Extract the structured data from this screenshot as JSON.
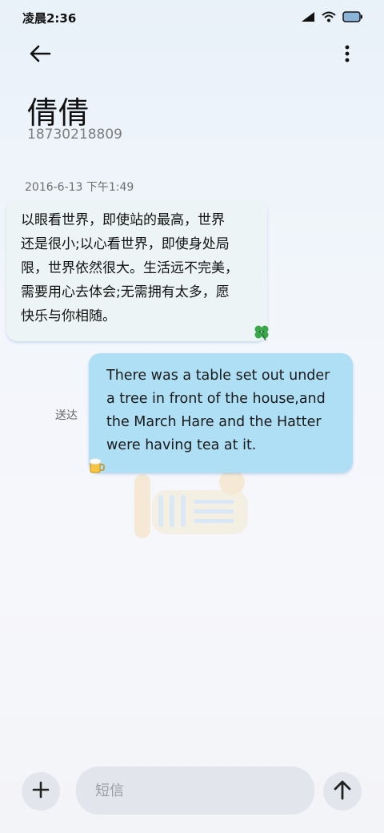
{
  "status_bar": {
    "time": "凌晨2:36",
    "icons": [
      "signal-icon",
      "wifi-icon",
      "battery-icon"
    ]
  },
  "header": {
    "back_icon": "back-arrow-icon",
    "more_icon": "more-vertical-icon",
    "contact_name": "倩倩",
    "contact_number": "18730218809"
  },
  "conversation": {
    "timestamp": "2016-6-13 下午1:49",
    "messages": [
      {
        "direction": "incoming",
        "text": "以眼看世界，即使站的最高，世界\n还是很小;以心看世界，即使身处局\n限，世界依然很大。生活远不完美，\n需要用心去体会;无需拥有太多，愿\n快乐与你相随。",
        "sticker": "clover-icon"
      },
      {
        "direction": "outgoing",
        "text": "There was a table set out under\na tree in front of the house,and\nthe March Hare and the Hatter\nwere having tea at it.",
        "status": "送达",
        "sticker": "beer-mug-icon"
      }
    ]
  },
  "composer": {
    "add_icon": "plus-icon",
    "placeholder": "短信",
    "value": "",
    "send_icon": "arrow-up-icon"
  },
  "colors": {
    "incoming_bubble": "#edf4f6",
    "outgoing_bubble": "#aedff5",
    "composer_bg": "#e2e6ec"
  }
}
